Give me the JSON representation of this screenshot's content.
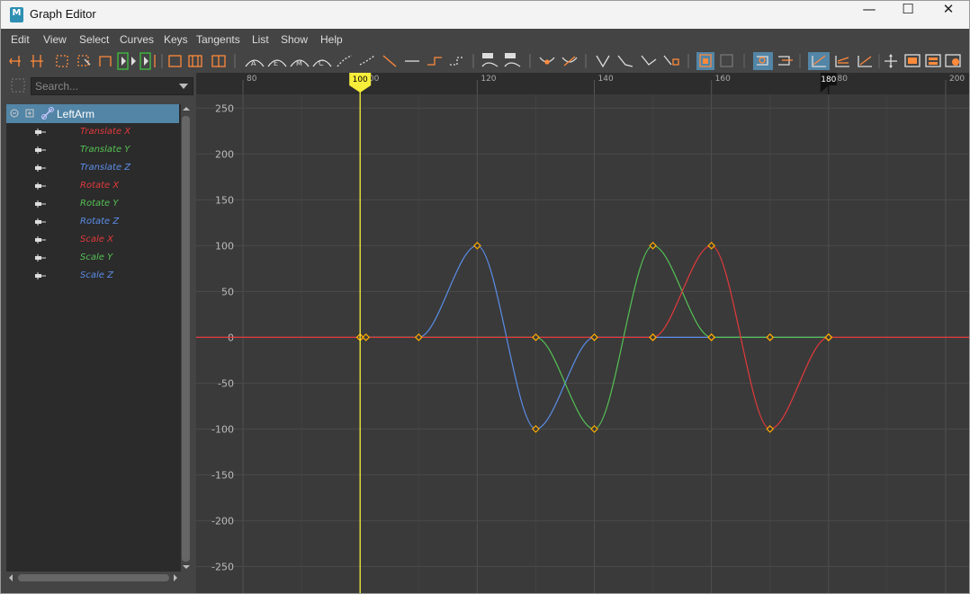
{
  "window": {
    "title": "Graph Editor",
    "app_icon_glyph": "M",
    "controls": {
      "minimize": "—",
      "maximize": "☐",
      "close": "✕"
    }
  },
  "menu": [
    "Edit",
    "View",
    "Select",
    "Curves",
    "Keys",
    "Tangents",
    "List",
    "Show",
    "Help"
  ],
  "toolbar": {
    "buttons": [
      "move-nearest-key",
      "insert-key",
      "box-select",
      "lattice-deform",
      "region-tool",
      "auto-frame",
      "frame-playback",
      "frame-all",
      "normalize-view",
      "stacked-view",
      "separate-view",
      "spline-tangent",
      "clamped-tangent",
      "linear-tangent",
      "flat-tangent",
      "step-tangent",
      "plateau-tangent",
      "auto-tangent",
      "break-tangent",
      "unify-tangent",
      "free-weight",
      "lock-weight",
      "pre-infinity",
      "post-infinity",
      "buffer-curve",
      "swap-buffer",
      "snap-keys",
      "auto-load",
      "time-snap",
      "value-snap",
      "normalize",
      "retime-tool",
      "channel-box",
      "curve-display",
      "dope-sheet",
      "settings"
    ],
    "active": [
      "curve-display-toggle",
      "retime-toggle",
      "tangent-view-toggle"
    ]
  },
  "outliner": {
    "search_placeholder": "Search...",
    "root": {
      "label": "LeftArm",
      "expanded": true
    },
    "channels": [
      {
        "label": "Translate X",
        "color": "#e2393b"
      },
      {
        "label": "Translate Y",
        "color": "#55c154"
      },
      {
        "label": "Translate Z",
        "color": "#5b8de8"
      },
      {
        "label": "Rotate X",
        "color": "#e2393b"
      },
      {
        "label": "Rotate Y",
        "color": "#55c154"
      },
      {
        "label": "Rotate Z",
        "color": "#5b8de8"
      },
      {
        "label": "Scale X",
        "color": "#e2393b"
      },
      {
        "label": "Scale Y",
        "color": "#55c154"
      },
      {
        "label": "Scale Z",
        "color": "#5b8de8"
      }
    ]
  },
  "graph": {
    "time_ticks": [
      "80",
      "100",
      "120",
      "140",
      "160",
      "180",
      "200"
    ],
    "value_ticks": [
      "250",
      "200",
      "150",
      "100",
      "50",
      "0",
      "-50",
      "-100",
      "-150",
      "-200",
      "-250"
    ],
    "current_frame": "100",
    "end_marker": "180",
    "colors": {
      "x": "#e2393b",
      "y": "#55c154",
      "z": "#5b8de8",
      "key": "#ffaa00",
      "current_time": "#f7ee3b"
    }
  },
  "chart_data": {
    "type": "line",
    "xlim": [
      72,
      204
    ],
    "ylim": [
      -280,
      265
    ],
    "series": [
      {
        "color": "#5b8de8",
        "keys": [
          [
            100,
            0
          ],
          [
            110,
            0
          ],
          [
            120,
            100
          ],
          [
            130,
            -100
          ],
          [
            140,
            0
          ],
          [
            150,
            0
          ],
          [
            160,
            0
          ],
          [
            170,
            0
          ],
          [
            180,
            0
          ]
        ]
      },
      {
        "color": "#55c154",
        "keys": [
          [
            100,
            0
          ],
          [
            130,
            0
          ],
          [
            140,
            -100
          ],
          [
            150,
            100
          ],
          [
            160,
            0
          ],
          [
            170,
            0
          ],
          [
            180,
            0
          ]
        ]
      },
      {
        "color": "#e2393b",
        "keys": [
          [
            72,
            0
          ],
          [
            100,
            0
          ],
          [
            150,
            0
          ],
          [
            160,
            100
          ],
          [
            170,
            -100
          ],
          [
            180,
            0
          ],
          [
            204,
            0
          ]
        ]
      }
    ],
    "selected_key": [
      120,
      0
    ]
  }
}
